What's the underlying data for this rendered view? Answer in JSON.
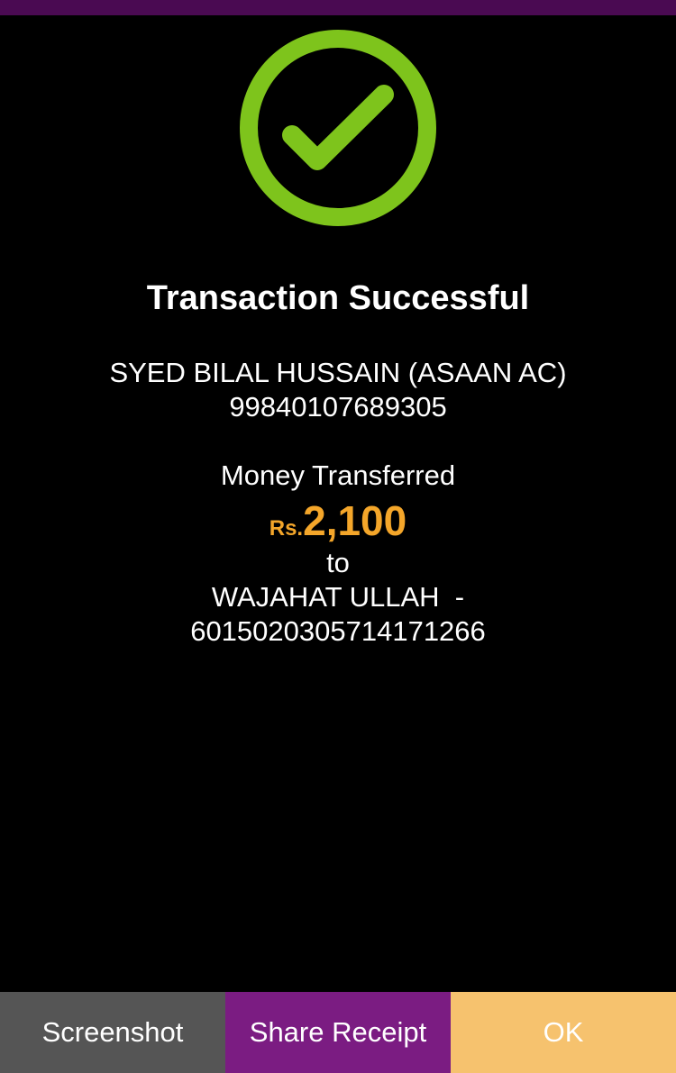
{
  "colors": {
    "top_bar": "#4a0a52",
    "success_green": "#7ec41c",
    "amount_orange": "#f4a62a",
    "screenshot_btn": "#555555",
    "share_btn": "#7b1c82",
    "ok_btn": "#f6c26e"
  },
  "status": {
    "icon": "check-circle-icon",
    "title": "Transaction Successful"
  },
  "sender": {
    "name": "SYED BILAL HUSSAIN (ASAAN AC)",
    "account": "99840107689305"
  },
  "transfer": {
    "label": "Money Transferred",
    "currency": "Rs.",
    "amount": "2,100",
    "to_label": "to",
    "recipient_name": "WAJAHAT ULLAH  -",
    "recipient_account": "6015020305714171266"
  },
  "actions": {
    "screenshot_label": "Screenshot",
    "share_label": "Share Receipt",
    "ok_label": "OK"
  }
}
